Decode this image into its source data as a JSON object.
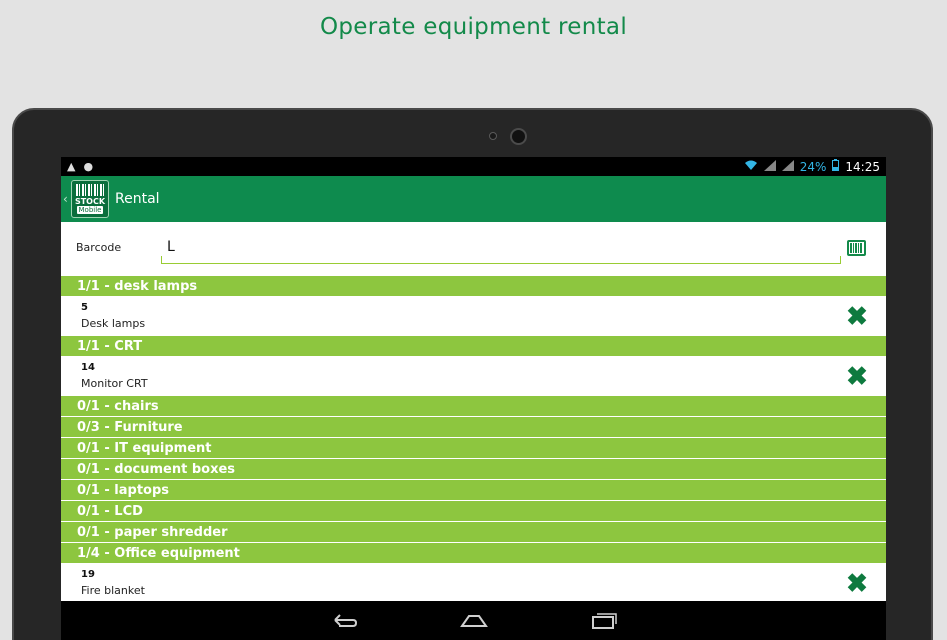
{
  "promo_title": "Operate equipment rental",
  "status_bar": {
    "battery": "24%",
    "time": "14:25"
  },
  "app": {
    "logo_line1": "STOCK",
    "logo_line2": "Mobile",
    "title": "Rental"
  },
  "barcode": {
    "label": "Barcode",
    "value": "L"
  },
  "groups": [
    {
      "header": "1/1 - desk lamps",
      "items": [
        {
          "qty": "5",
          "name": "Desk lamps"
        }
      ]
    },
    {
      "header": "1/1 - CRT",
      "items": [
        {
          "qty": "14",
          "name": "Monitor CRT"
        }
      ]
    },
    {
      "header": "0/1 - chairs"
    },
    {
      "header": "0/3 - Furniture"
    },
    {
      "header": "0/1 - IT equipment"
    },
    {
      "header": "0/1 - document boxes"
    },
    {
      "header": "0/1 - laptops"
    },
    {
      "header": "0/1 - LCD"
    },
    {
      "header": "0/1 - paper shredder"
    },
    {
      "header": "1/4 - Office equipment",
      "items": [
        {
          "qty": "19",
          "name": "Fire blanket"
        }
      ]
    }
  ],
  "icons": {
    "delete": "close-icon",
    "scan": "barcode-scan-icon",
    "nav": [
      "back-icon",
      "home-icon",
      "recent-apps-icon"
    ]
  },
  "colors": {
    "appbar": "#0e8b4e",
    "group_header": "#8dc63f",
    "accent": "#138a4a"
  }
}
